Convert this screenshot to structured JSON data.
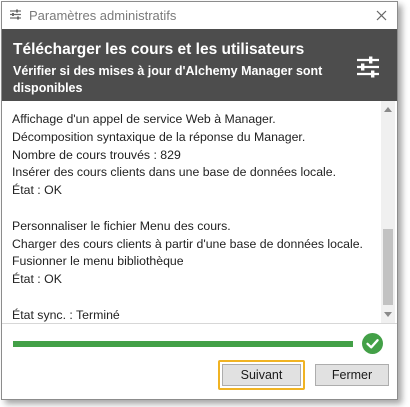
{
  "window": {
    "title": "Paramètres administratifs",
    "icon": "settings-sliders-icon"
  },
  "header": {
    "heading": "Télécharger les cours et les utilisateurs",
    "subheading": "Vérifier si des mises à jour d'Alchemy Manager sont disponibles",
    "icon": "sliders-icon"
  },
  "log": {
    "lines": [
      "Affichage d'un appel de service Web à Manager.",
      "Décomposition syntaxique de la réponse du Manager.",
      "Nombre de cours trouvés : 829",
      "Insérer des cours clients dans une base de données locale.",
      "État : OK",
      "",
      "Personnaliser le fichier Menu des cours.",
      "Charger des cours clients à partir d'une base de données locale.",
      "Fusionner le menu bibliothèque",
      "État : OK",
      "",
      "État sync. : Terminé"
    ]
  },
  "progress": {
    "value": 1.0,
    "color": "#43a047"
  },
  "buttons": {
    "next": "Suivant",
    "close": "Fermer"
  },
  "colors": {
    "header_bg": "#4d4d4d",
    "highlight": "#f0b323",
    "success": "#43a047"
  }
}
